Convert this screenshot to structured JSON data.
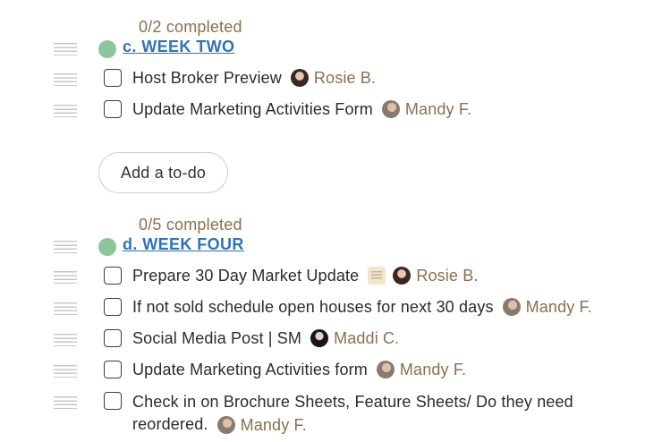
{
  "groups": [
    {
      "progress": "0/2 completed",
      "title": "c. WEEK TWO",
      "todos": [
        {
          "text": "Host Broker Preview",
          "assignee": "Rosie B.",
          "avatar": "rosie"
        },
        {
          "text": "Update Marketing Activities Form",
          "assignee": "Mandy F.",
          "avatar": "mandy"
        }
      ],
      "add_label": "Add a to-do"
    },
    {
      "progress": "0/5 completed",
      "title": "d. WEEK FOUR",
      "todos": [
        {
          "text": "Prepare 30 Day Market Update",
          "assignee": "Rosie B.",
          "avatar": "rosie",
          "has_doc_icon": true
        },
        {
          "text": "If not sold schedule open houses for next 30 days",
          "assignee": "Mandy F.",
          "avatar": "mandy"
        },
        {
          "text": "Social Media Post | SM",
          "assignee": "Maddi C.",
          "avatar": "maddi"
        },
        {
          "text": "Update Marketing Activities form",
          "assignee": "Mandy F.",
          "avatar": "mandy"
        },
        {
          "text": "Check in on Brochure Sheets, Feature Sheets/ Do they need reordered.",
          "assignee": "Mandy F.",
          "avatar": "mandy"
        }
      ]
    }
  ],
  "colors": {
    "accent_link": "#2f73b9",
    "progress_text": "#8a6f4c",
    "status_dot": "#8bc69a"
  },
  "icons": {
    "drag": "drag-handle-icon",
    "checkbox": "checkbox-icon",
    "doc": "notes-document-icon"
  }
}
